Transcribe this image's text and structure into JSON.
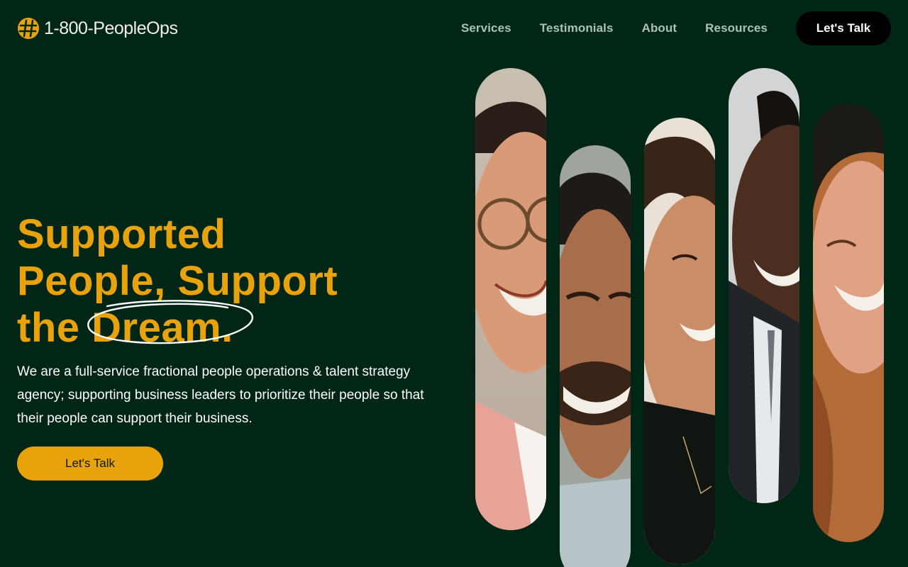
{
  "brand": {
    "name": "1-800-PeopleOps",
    "logo_icon": "hash-globe-icon",
    "accent_color": "#E8A20C",
    "background_color": "#012615"
  },
  "nav": {
    "links": [
      "Services",
      "Testimonials",
      "About",
      "Resources"
    ],
    "cta_label": "Let's Talk"
  },
  "hero": {
    "headline_line1": "Supported",
    "headline_line2": "People, Support",
    "headline_line3_prefix": "the ",
    "headline_circled_word": "Dream.",
    "description": "We are a full-service fractional people operations & talent strategy agency; supporting business leaders to prioritize their people so that their people can support their business.",
    "cta_label": "Let's Talk"
  },
  "photos": [
    {
      "icon": "portrait-woman-glasses-photo"
    },
    {
      "icon": "portrait-man-smiling-photo"
    },
    {
      "icon": "portrait-woman-smiling-photo"
    },
    {
      "icon": "portrait-man-suit-photo"
    },
    {
      "icon": "portrait-woman-laughing-photo"
    }
  ]
}
